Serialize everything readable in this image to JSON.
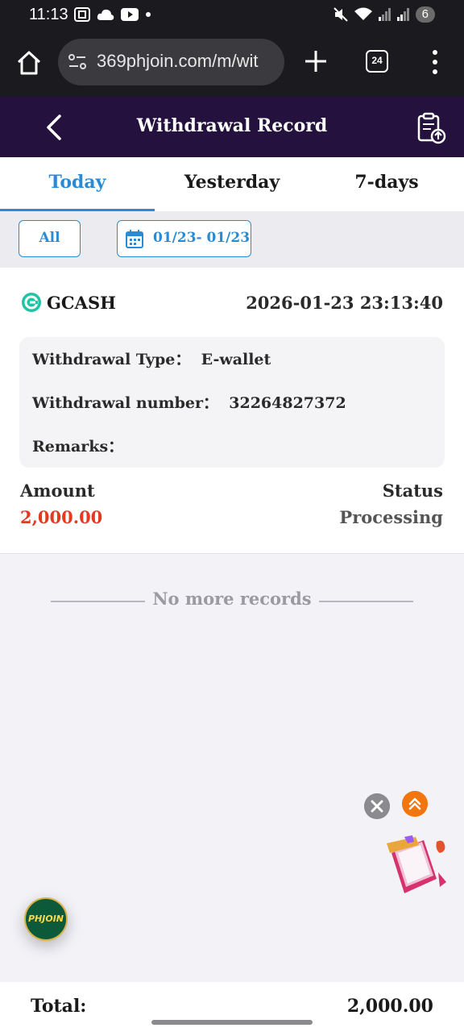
{
  "status_bar": {
    "time": "11:13",
    "left_icons": [
      "screenshot-icon",
      "cloud-icon",
      "youtube-icon",
      "dot-icon"
    ],
    "right_icons": [
      "mute-icon",
      "wifi-icon",
      "signal-icon",
      "signal-icon"
    ],
    "battery": "6"
  },
  "browser": {
    "url": "369phjoin.com/m/wit",
    "tab_count": "24"
  },
  "header": {
    "title": "Withdrawal Record"
  },
  "tabs": [
    {
      "label": "Today",
      "active": true
    },
    {
      "label": "Yesterday",
      "active": false
    },
    {
      "label": "7-days",
      "active": false
    }
  ],
  "filters": {
    "all_label": "All",
    "date_range": "01/23- 01/23"
  },
  "record": {
    "method": "GCASH",
    "datetime": "2026-01-23 23:13:40",
    "type_line": "Withdrawal Type：  E-wallet",
    "number_line": "Withdrawal number：  32264827372",
    "remarks_line": "Remarks：",
    "amount_label": "Amount",
    "amount": "2,000.00",
    "status_label": "Status",
    "status": "Processing"
  },
  "no_more": "No more records",
  "floating": {
    "logo_text": "PHJOIN"
  },
  "footer": {
    "total_label": "Total:",
    "total_value": "2,000.00"
  },
  "colors": {
    "header_bg": "#24113e",
    "accent": "#2a8bd5",
    "amount": "#e33a22"
  }
}
